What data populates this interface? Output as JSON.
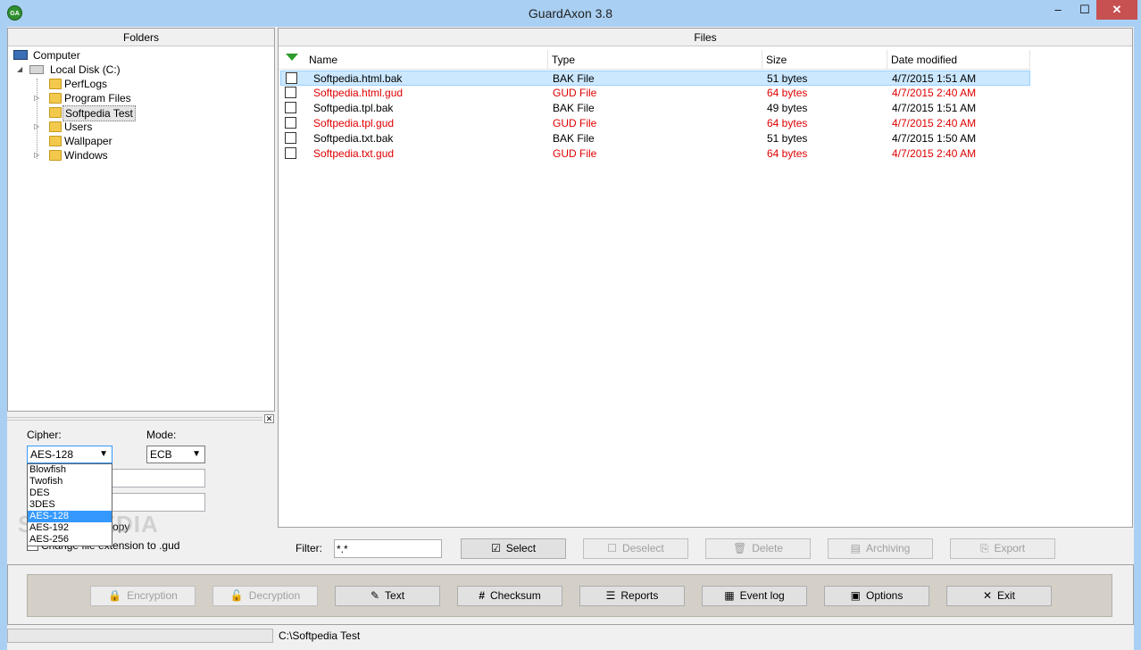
{
  "window": {
    "title": "GuardAxon 3.8",
    "icon_text": "GA",
    "min_glyph": "–",
    "max_glyph": "☐",
    "close_glyph": "✕"
  },
  "folders": {
    "header": "Folders",
    "tree": {
      "computer": "Computer",
      "disk": "Local Disk (C:)",
      "folders": [
        "PerfLogs",
        "Program Files",
        "Softpedia Test",
        "Users",
        "Wallpaper",
        "Windows"
      ],
      "selected": "Softpedia Test"
    }
  },
  "cipher_section": {
    "cipher_label": "Cipher:",
    "cipher_value": "AES-128",
    "mode_label": "Mode:",
    "mode_value": "ECB",
    "cipher_options": [
      "Blowfish",
      "Twofish",
      "DES",
      "3DES",
      "AES-128",
      "AES-192",
      "AES-256"
    ],
    "cipher_selected_index": 4,
    "option_copy_partial": "opy",
    "option_extension": "Change file extension to .gud",
    "watermark": "SOFTPEDIA"
  },
  "files": {
    "header": "Files",
    "columns": [
      "Name",
      "Type",
      "Size",
      "Date modified"
    ],
    "rows": [
      {
        "name": "Softpedia.html.bak",
        "type": "BAK File",
        "size": "51 bytes",
        "date": "4/7/2015 1:51 AM",
        "red": false
      },
      {
        "name": "Softpedia.html.gud",
        "type": "GUD File",
        "size": "64 bytes",
        "date": "4/7/2015 2:40 AM",
        "red": true
      },
      {
        "name": "Softpedia.tpl.bak",
        "type": "BAK File",
        "size": "49 bytes",
        "date": "4/7/2015 1:51 AM",
        "red": false
      },
      {
        "name": "Softpedia.tpl.gud",
        "type": "GUD File",
        "size": "64 bytes",
        "date": "4/7/2015 2:40 AM",
        "red": true
      },
      {
        "name": "Softpedia.txt.bak",
        "type": "BAK File",
        "size": "51 bytes",
        "date": "4/7/2015 1:50 AM",
        "red": false
      },
      {
        "name": "Softpedia.txt.gud",
        "type": "GUD File",
        "size": "64 bytes",
        "date": "4/7/2015 2:40 AM",
        "red": true
      }
    ]
  },
  "filter_bar": {
    "filter_label": "Filter:",
    "filter_value": "*.*",
    "select": "Select",
    "deselect": "Deselect",
    "delete": "Delete",
    "archiving": "Archiving",
    "export": "Export"
  },
  "toolbar": {
    "encryption": "Encryption",
    "decryption": "Decryption",
    "text": "Text",
    "checksum": "Checksum",
    "reports": "Reports",
    "event_log": "Event log",
    "options": "Options",
    "exit": "Exit"
  },
  "status": {
    "path": "C:\\Softpedia Test"
  },
  "colors": {
    "title_bar": "#a9cff3",
    "close_button": "#c75050",
    "gud_file_text": "#e00000",
    "selected_row": "#cce8ff",
    "list_selection": "#3399ff"
  }
}
